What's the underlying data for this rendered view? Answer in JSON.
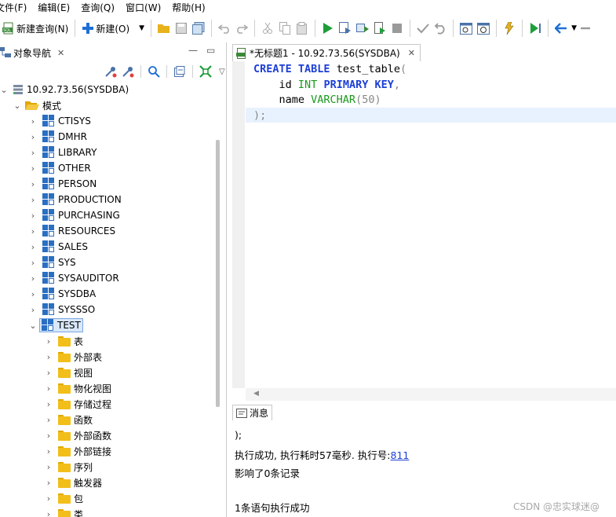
{
  "menu": [
    "文件(F)",
    "编辑(E)",
    "查询(Q)",
    "窗口(W)",
    "帮助(H)"
  ],
  "toolbar": {
    "new_query_label": "新建查询(N)",
    "new_label": "新建(O)"
  },
  "left_panel": {
    "tab_label": "对象导航",
    "connection": "10.92.73.56(SYSDBA)",
    "schema_group": "模式",
    "schemas": [
      "CTISYS",
      "DMHR",
      "LIBRARY",
      "OTHER",
      "PERSON",
      "PRODUCTION",
      "PURCHASING",
      "RESOURCES",
      "SALES",
      "SYS",
      "SYSAUDITOR",
      "SYSDBA",
      "SYSSSO",
      "TEST"
    ],
    "selected_schema": "TEST",
    "test_children": [
      "表",
      "外部表",
      "视图",
      "物化视图",
      "存储过程",
      "函数",
      "外部函数",
      "外部链接",
      "序列",
      "触发器",
      "包",
      "类"
    ]
  },
  "editor": {
    "tab_label": "*无标题1 - 10.92.73.56(SYSDBA)",
    "code": {
      "l1": [
        "CREATE",
        " ",
        "TABLE",
        " test_table",
        "("
      ],
      "l2": [
        "    id ",
        "INT",
        " ",
        "PRIMARY",
        " ",
        "KEY",
        ","
      ],
      "l3": [
        "    name ",
        "VARCHAR",
        "(",
        "50",
        ")"
      ],
      "l4": [
        ");"
      ]
    }
  },
  "messages": {
    "tab_label": "消息",
    "line_partial": ");",
    "success_prefix": "执行成功, 执行耗时57毫秒. 执行号:",
    "exec_number": "811",
    "affected": "影响了0条记录",
    "summary": "1条语句执行成功"
  },
  "watermark": "CSDN @忠实球迷@",
  "colors": {
    "keyword": "#1d3fd6",
    "type": "#1a9a1a",
    "selection": "#d9e8fb",
    "current_line": "#e8f2fe"
  }
}
